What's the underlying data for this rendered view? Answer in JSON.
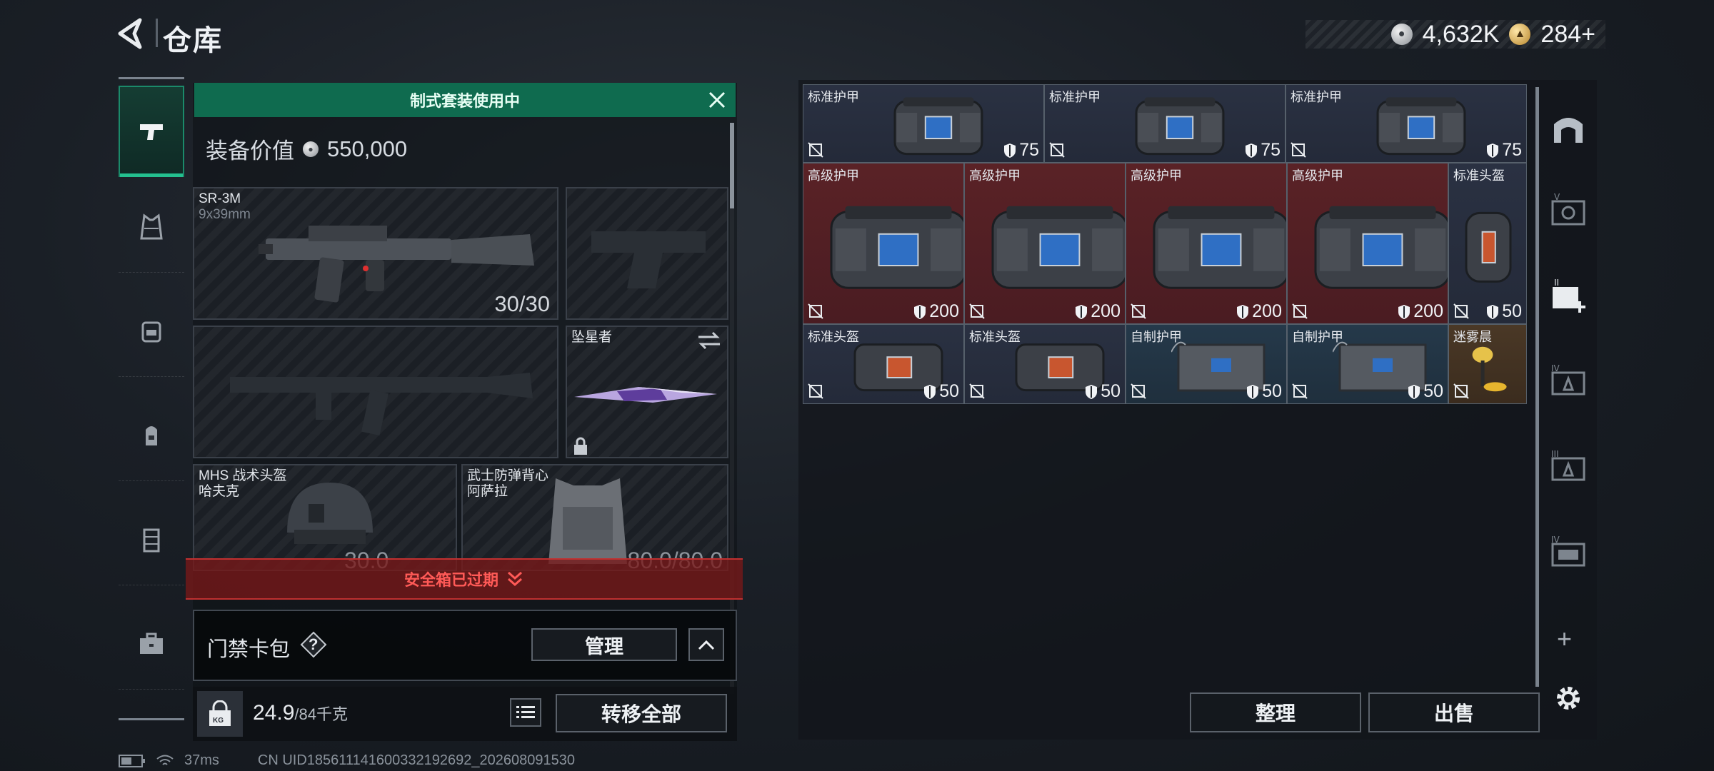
{
  "header": {
    "title": "仓库",
    "currency_silver": "4,632K",
    "currency_gold": "284+"
  },
  "loadout": {
    "kit_banner": "制式套装使用中",
    "value_label": "装备价值",
    "value": "550,000",
    "primary_weapon": {
      "name": "SR-3M",
      "caliber": "9x39mm",
      "ammo": "30/30"
    },
    "melee": {
      "name": "坠星者"
    },
    "helmet": {
      "name": "MHS 战术头盔",
      "sub": "哈夫克",
      "durability": "30.0"
    },
    "armor": {
      "name": "武士防弹背心",
      "sub": "阿萨拉",
      "durability": "80.0/80.0"
    },
    "safebox_expired": "安全箱已过期",
    "keycard_label": "门禁卡包",
    "keycard_help": "?",
    "manage_label": "管理",
    "weight_value": "24.9",
    "weight_max": "/84千克",
    "transfer_all": "转移全部",
    "kg_tag": "KG"
  },
  "storage": {
    "items": [
      {
        "name": "标准护甲",
        "tier": "std",
        "durability": "75",
        "kind": "armor-small"
      },
      {
        "name": "标准护甲",
        "tier": "std",
        "durability": "75",
        "kind": "armor-small"
      },
      {
        "name": "标准护甲",
        "tier": "std",
        "durability": "75",
        "kind": "armor-small"
      },
      {
        "name": "高级护甲",
        "tier": "adv",
        "durability": "200",
        "kind": "armor-big"
      },
      {
        "name": "高级护甲",
        "tier": "adv",
        "durability": "200",
        "kind": "armor-big"
      },
      {
        "name": "高级护甲",
        "tier": "adv",
        "durability": "200",
        "kind": "armor-big"
      },
      {
        "name": "高级护甲",
        "tier": "adv",
        "durability": "200",
        "kind": "armor-big"
      },
      {
        "name": "标准头盔",
        "tier": "std",
        "durability": "50",
        "kind": "helmet-tall"
      },
      {
        "name": "标准头盔",
        "tier": "std",
        "durability": "50",
        "kind": "helmet"
      },
      {
        "name": "标准头盔",
        "tier": "std",
        "durability": "50",
        "kind": "helmet"
      },
      {
        "name": "自制护甲",
        "tier": "mk",
        "durability": "50",
        "kind": "makeshift"
      },
      {
        "name": "自制护甲",
        "tier": "mk",
        "durability": "50",
        "kind": "makeshift"
      },
      {
        "name": "迷雾晨",
        "tier": "gold",
        "durability": "",
        "kind": "lamp"
      }
    ],
    "sort_label": "整理",
    "sell_label": "出售"
  },
  "right_rail": {
    "add_label": "+"
  },
  "status": {
    "ping": "37ms",
    "uid": "CN UID1856111416003321926​92_202608091530"
  },
  "colors": {
    "accent_green": "#0f6b4f",
    "expired_red": "#ff5a57",
    "tier_standard": "#2a3142",
    "tier_advanced": "#5a2226",
    "tier_makeshift": "#25394a"
  }
}
